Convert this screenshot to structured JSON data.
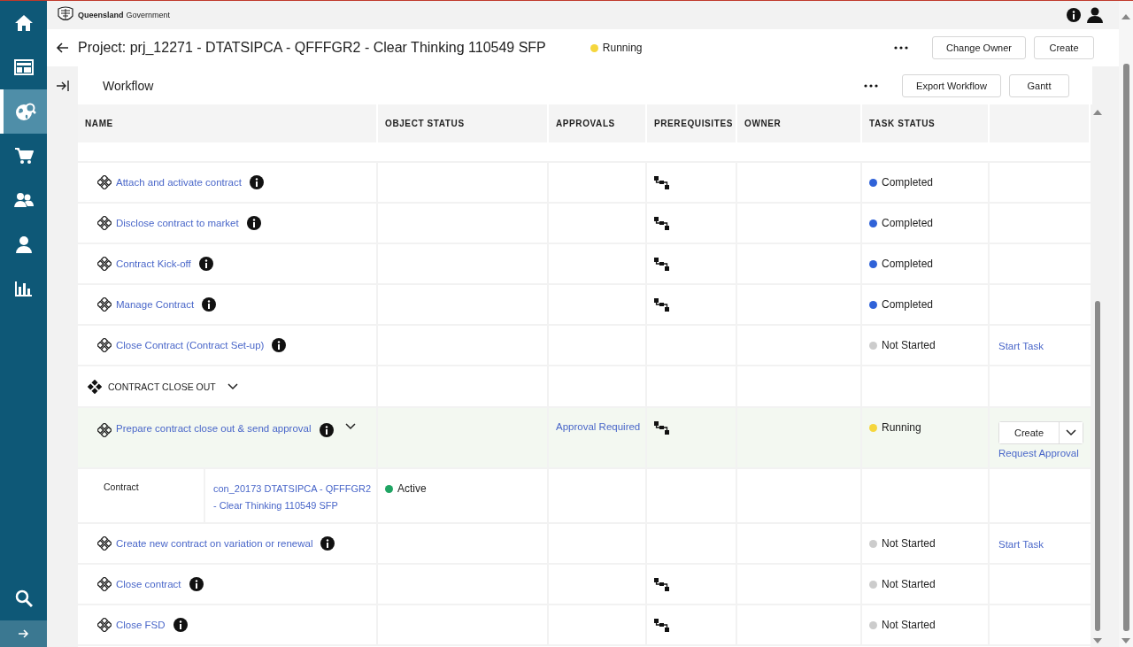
{
  "sidebar": {
    "items": [
      {
        "kind": "home",
        "selected": false
      },
      {
        "kind": "layout",
        "selected": false
      },
      {
        "kind": "globe",
        "selected": true
      },
      {
        "kind": "cart",
        "selected": false
      },
      {
        "kind": "people",
        "selected": false
      },
      {
        "kind": "person",
        "selected": false
      },
      {
        "kind": "chart",
        "selected": false
      }
    ],
    "bottom": [
      {
        "kind": "search"
      },
      {
        "kind": "arrow"
      }
    ]
  },
  "topbar": {
    "logo_bold": "Queensland",
    "logo_text": "Government"
  },
  "header": {
    "title": "Project: prj_12271 - DTATSIPCA - QFFFGR2 - Clear Thinking 110549 SFP",
    "status": {
      "label": "Running",
      "color": "#f5d63d"
    },
    "buttons": [
      "Change Owner",
      "Create"
    ]
  },
  "section": {
    "title": "Workflow",
    "buttons": [
      "Export Workflow",
      "Gantt"
    ]
  },
  "table": {
    "columns": [
      "NAME",
      "OBJECT STATUS",
      "APPROVALS",
      "PREREQUISITES",
      "OWNER",
      "TASK STATUS"
    ],
    "rows": [
      {
        "kind": "task",
        "name": "Attach and activate contract",
        "prerequisites": true,
        "status": {
          "label": "Completed",
          "color": "#2f62d8"
        }
      },
      {
        "kind": "task",
        "name": "Disclose contract to market",
        "prerequisites": true,
        "status": {
          "label": "Completed",
          "color": "#2f62d8"
        }
      },
      {
        "kind": "task",
        "name": "Contract Kick-off",
        "prerequisites": true,
        "status": {
          "label": "Completed",
          "color": "#2f62d8"
        }
      },
      {
        "kind": "task",
        "name": "Manage Contract",
        "prerequisites": true,
        "status": {
          "label": "Completed",
          "color": "#2f62d8"
        }
      },
      {
        "kind": "task",
        "name": "Close Contract (Contract Set-up)",
        "prerequisites": false,
        "status": {
          "label": "Not Started",
          "color": "#cccccc"
        },
        "action": {
          "kind": "link",
          "label": "Start Task"
        }
      },
      {
        "kind": "section",
        "name": "CONTRACT CLOSE OUT",
        "expanded": true
      },
      {
        "kind": "task",
        "name": "Prepare contract close out & send approval",
        "expanded": true,
        "highlighted": true,
        "approvals": "Approval Required",
        "prerequisites": true,
        "status": {
          "label": "Running",
          "color": "#f5d63d"
        },
        "action": {
          "kind": "split",
          "label": "Create",
          "link": "Request Approval"
        }
      },
      {
        "kind": "object",
        "type": "Contract",
        "name": "con_20173 DTATSIPCA - QFFFGR2 - Clear Thinking 110549 SFP",
        "status": {
          "label": "Active",
          "color": "#1fa463"
        }
      },
      {
        "kind": "task",
        "name": "Create new contract on variation or renewal",
        "prerequisites": false,
        "status": {
          "label": "Not Started",
          "color": "#cccccc"
        },
        "action": {
          "kind": "link",
          "label": "Start Task"
        }
      },
      {
        "kind": "task",
        "name": "Close contract",
        "prerequisites": true,
        "status": {
          "label": "Not Started",
          "color": "#cccccc"
        }
      },
      {
        "kind": "task",
        "name": "Close FSD",
        "prerequisites": true,
        "status": {
          "label": "Not Started",
          "color": "#cccccc"
        }
      }
    ]
  }
}
